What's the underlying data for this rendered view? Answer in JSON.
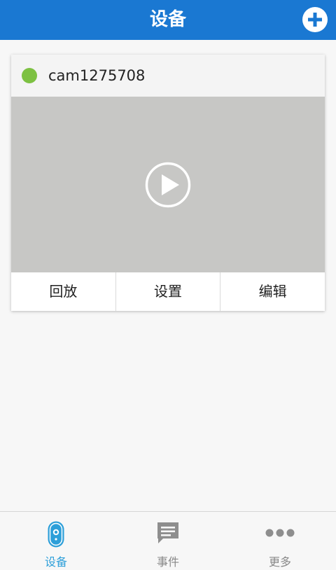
{
  "header": {
    "title": "设备"
  },
  "device": {
    "name": "cam1275708",
    "status_color": "#7dc142",
    "actions": [
      {
        "label": "回放"
      },
      {
        "label": "设置"
      },
      {
        "label": "编辑"
      }
    ]
  },
  "tabs": [
    {
      "label": "设备",
      "icon": "camera-icon",
      "active": true
    },
    {
      "label": "事件",
      "icon": "chat-icon",
      "active": false
    },
    {
      "label": "更多",
      "icon": "more-dots-icon",
      "active": false
    }
  ],
  "colors": {
    "header": "#1a78d2",
    "active_tab": "#2d9fd9",
    "inactive_tab": "#888888",
    "preview_bg": "#c7c7c5"
  }
}
